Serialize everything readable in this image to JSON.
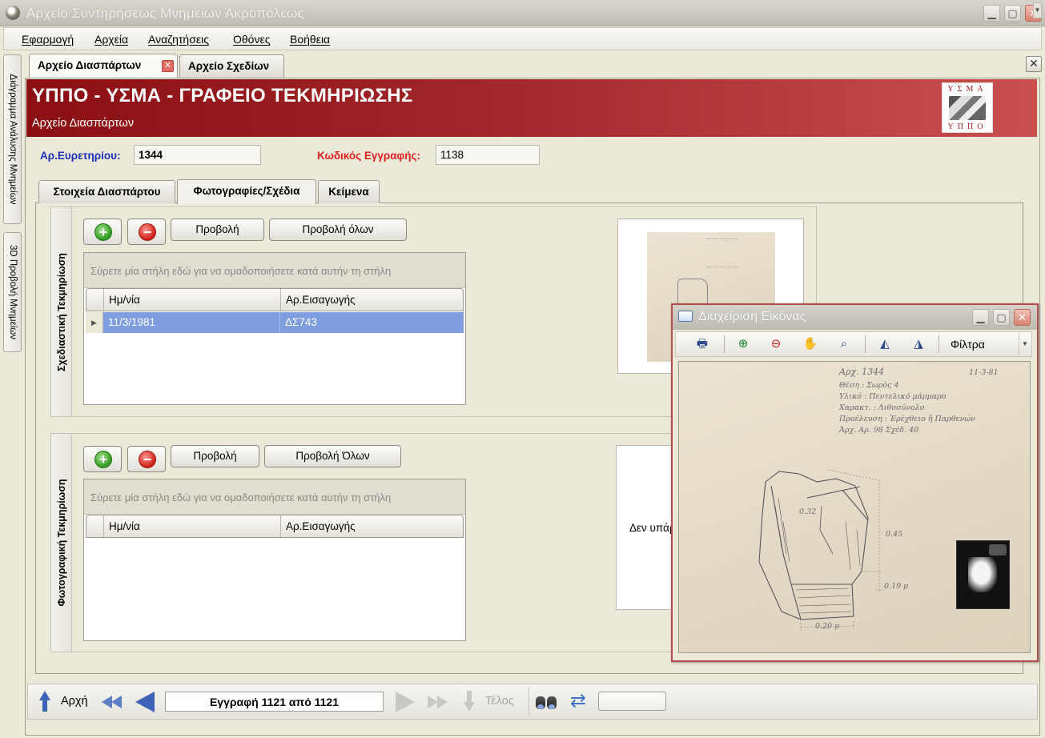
{
  "window": {
    "title": "Αρχείο Συντηρήσεως Μνημείων Ακροπόλεως"
  },
  "menu": [
    "Εφαρμογή",
    "Αρχεία",
    "Αναζητήσεις",
    "Οθόνες",
    "Βοήθεια"
  ],
  "side_tabs": [
    "Διάγραμμα Ανάλυσης Μνημείων",
    "3D Προβολή Μνημείων"
  ],
  "doc_tabs": [
    {
      "label": "Αρχείο Διασπάρτων",
      "active": true
    },
    {
      "label": "Αρχείο Σχεδίων",
      "active": false
    }
  ],
  "banner": {
    "title": "ΥΠΠΟ - ΥΣΜΑ - ΓΡΑΦΕΙΟ ΤΕΚΜΗΡΙΩΣΗΣ",
    "subtitle": "Αρχείο Διασπάρτων",
    "logo_top": "ΥΣΜΑ",
    "logo_bottom": "ΥΠΠΟ"
  },
  "fields": {
    "inventory_label": "Αρ.Ευρετηρίου:",
    "inventory_value": "1344",
    "record_code_label": "Κωδικός Εγγραφής:",
    "record_code_value": "1138"
  },
  "inner_tabs": [
    {
      "label": "Στοιχεία Διασπάρτου",
      "active": false
    },
    {
      "label": "Φωτογραφίες/Σχέδια",
      "active": true
    },
    {
      "label": "Κείμενα",
      "active": false
    }
  ],
  "drawing_section": {
    "title": "Σχεδιαστική Τεκμηρίωση",
    "view_label": "Προβολή",
    "view_all_label": "Προβολή όλων",
    "group_hint": "Σύρετε μία στήλη εδώ για να ομαδοποιήσετε κατά αυτήν τη στήλη",
    "columns": [
      "Ημ/νία",
      "Αρ.Εισαγωγής"
    ],
    "rows": [
      {
        "date": "11/3/1981",
        "entry": "ΔΣ743"
      }
    ]
  },
  "photo_section": {
    "title": "Φωτογραφική Τεκμηρίωση",
    "view_label": "Προβολή",
    "view_all_label": "Προβολή Όλων",
    "group_hint": "Σύρετε μία στήλη εδώ για να ομαδοποιήσετε κατά αυτήν τη στήλη",
    "columns": [
      "Ημ/νία",
      "Αρ.Εισαγωγής"
    ],
    "rows": [],
    "no_image_text": "Δεν υπάρ"
  },
  "nav": {
    "first_label": "Αρχή",
    "record_text": "Εγγραφή 1121 από 1121",
    "last_label": "Τέλος"
  },
  "image_window": {
    "title": "Διαχείριση Εικόνας",
    "filters_label": "Φίλτρα",
    "sketch_notes": {
      "number": "Αρχ. 1344",
      "date": "11-3-81",
      "lines": [
        "Θέση : Σωρὸς 4",
        "Υλικό : Πεντελικό μάρμαρο",
        "Χαρακτ. : Λιθοσύνολο",
        "Προέλευση : Ἐρέχθειο ἢ Παρθενών",
        "Ἀρχ. Αρ. 98 Σχέδ. 40"
      ],
      "dims": [
        "0.32",
        "0.45",
        "0.19 μ",
        "0.20 μ"
      ]
    }
  },
  "icons": [
    "app-icon",
    "minimize-icon",
    "maximize-icon",
    "close-icon",
    "add-icon",
    "remove-icon",
    "print-icon",
    "zoom-in-icon",
    "zoom-out-icon",
    "pan-hand-icon",
    "magnifier-icon",
    "flip-horizontal-icon",
    "flip-vertical-icon",
    "binoculars-icon",
    "refresh-icon",
    "first-arrow-icon",
    "previous-arrows-icon",
    "previous-icon",
    "next-icon",
    "next-arrows-icon",
    "last-arrow-icon"
  ]
}
